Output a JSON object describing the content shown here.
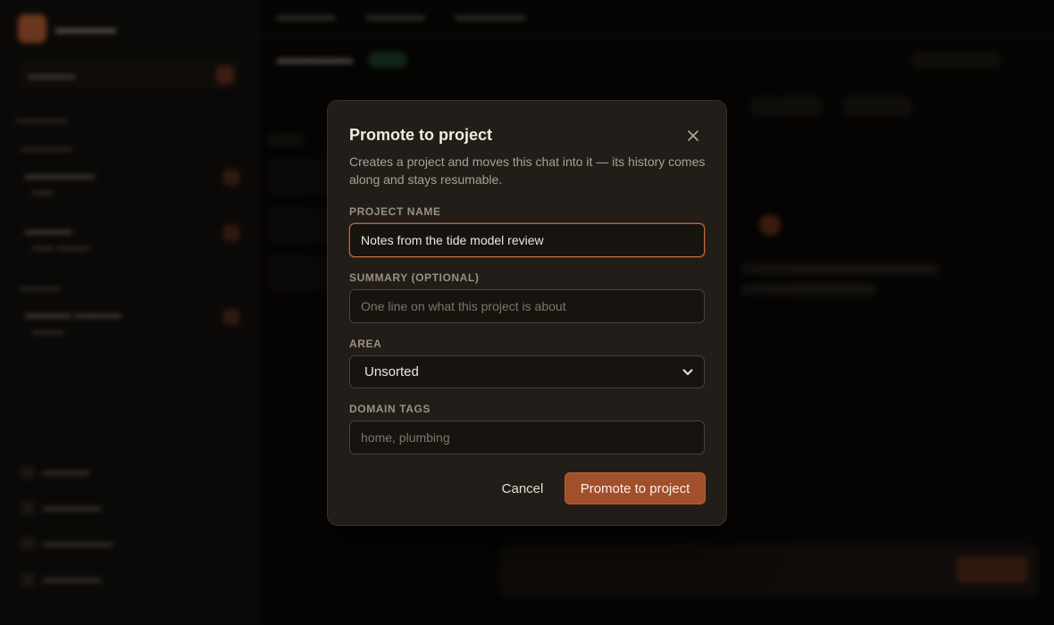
{
  "modal": {
    "title": "Promote to project",
    "description": "Creates a project and moves this chat into it — its history comes along and stays resumable.",
    "close_icon": "close-icon",
    "fields": {
      "project_name": {
        "label": "PROJECT NAME",
        "value": "Notes from the tide model review",
        "placeholder": ""
      },
      "summary": {
        "label": "SUMMARY (OPTIONAL)",
        "value": "",
        "placeholder": "One line on what this project is about"
      },
      "area": {
        "label": "AREA",
        "selected": "Unsorted",
        "icon": "chevron-down-icon"
      },
      "domain_tags": {
        "label": "DOMAIN TAGS",
        "value": "",
        "placeholder": "home, plumbing"
      }
    },
    "buttons": {
      "cancel": "Cancel",
      "submit": "Promote to project"
    }
  },
  "colors": {
    "accent": "#a24f2c",
    "focus_ring": "#c0663c",
    "modal_bg": "#221d18",
    "page_bg": "#0b0907"
  }
}
